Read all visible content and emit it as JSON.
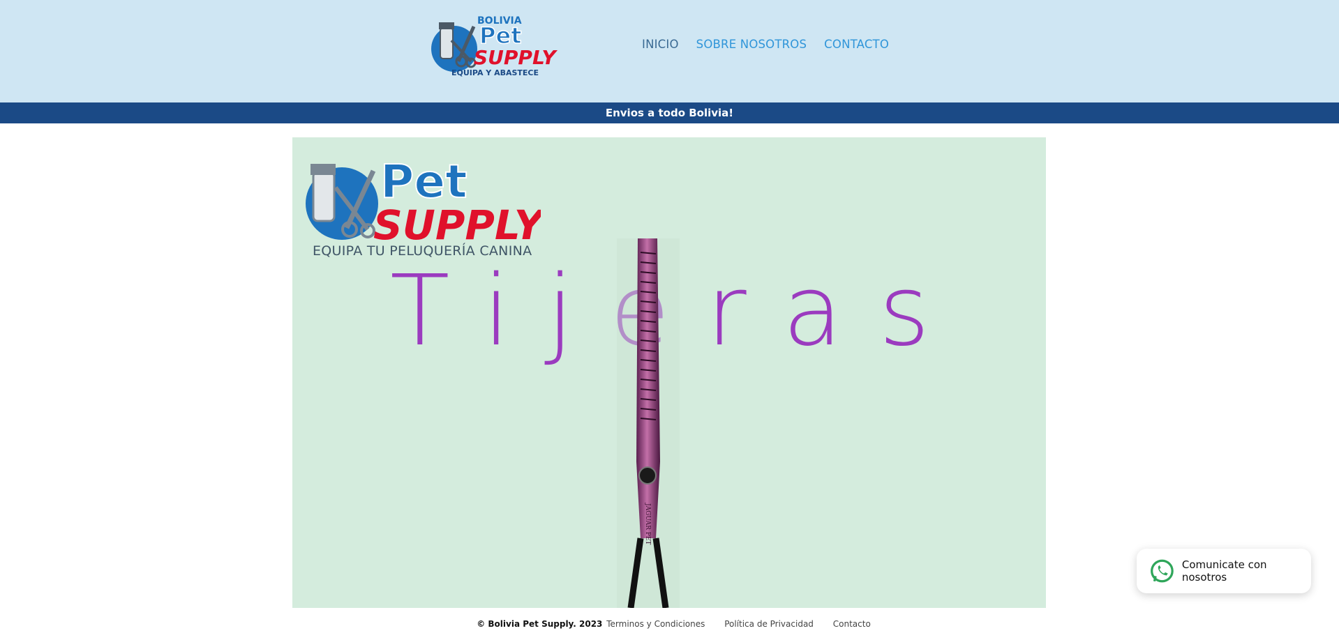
{
  "header": {
    "logo": {
      "country": "BOLIVIA",
      "brand_top": "Pet",
      "brand_bottom": "SUPPLY",
      "slogan": "EQUIPA Y ABASTECE"
    },
    "nav": [
      {
        "label": "INICIO"
      },
      {
        "label": "SOBRE NOSOTROS"
      },
      {
        "label": "CONTACTO"
      }
    ]
  },
  "announcement": "Envios a todo Bolivia!",
  "hero": {
    "logo_top": "Pet",
    "logo_bottom": "SUPPLY",
    "tagline": "EQUIPA TU PELUQUERÍA CANINA",
    "title": "Tijeras",
    "scissors_engraving": "JAGUAR PET"
  },
  "footer": {
    "copyright": "© Bolivia Pet Supply. 2023",
    "links": [
      {
        "label": "Terminos y Condiciones"
      },
      {
        "label": "Política de Privacidad"
      },
      {
        "label": "Contacto"
      }
    ]
  },
  "whatsapp": {
    "label": "Comunicate con nosotros",
    "icon": "whatsapp-icon"
  },
  "colors": {
    "header_bg": "#cfe6f3",
    "announce_bg": "#1b4a86",
    "hero_bg": "#d4ecdd",
    "brand_blue": "#1e73be",
    "brand_red": "#e0112b",
    "title_purple": "#9b3bbf",
    "nav_link": "#2f95d9"
  }
}
